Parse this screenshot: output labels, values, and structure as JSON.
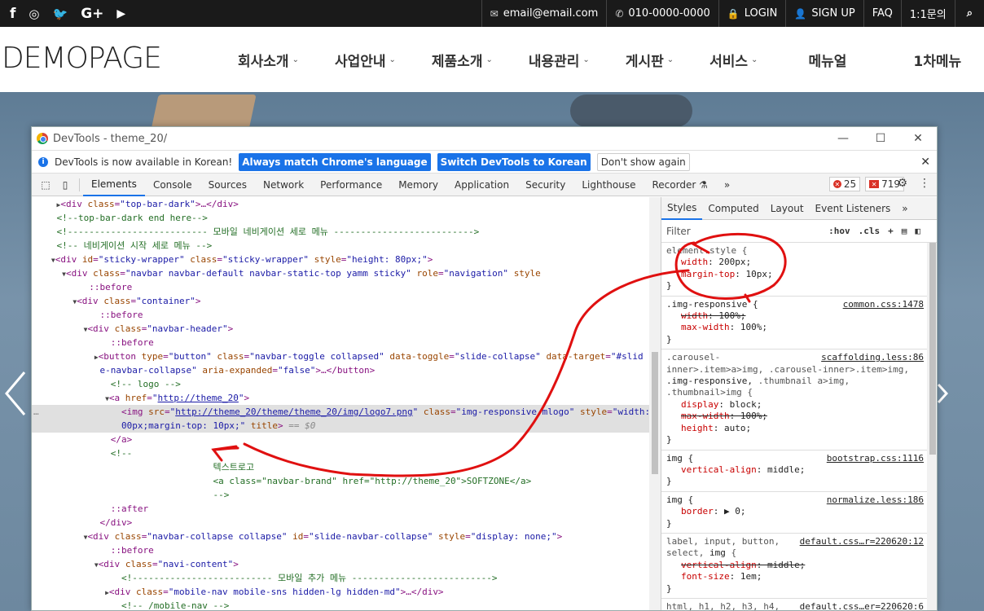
{
  "topbar": {
    "social": [
      "f",
      "ig",
      "tw",
      "G+",
      "yt"
    ],
    "email": "email@email.com",
    "phone": "010-0000-0000",
    "login": "LOGIN",
    "signup": "SIGN UP",
    "faq": "FAQ",
    "inquiry": "1:1문의"
  },
  "header": {
    "logo": "DEMOPAGE",
    "nav": [
      "회사소개",
      "사업안내",
      "제품소개",
      "내용관리",
      "게시판",
      "서비스",
      "메뉴얼",
      "1차메뉴"
    ]
  },
  "devtools": {
    "title": "DevTools - theme_20/",
    "infobar": {
      "message": "DevTools is now available in Korean!",
      "btn_match": "Always match Chrome's language",
      "btn_switch": "Switch DevTools to Korean",
      "btn_dismiss": "Don't show again"
    },
    "tabs": [
      "Elements",
      "Console",
      "Sources",
      "Network",
      "Performance",
      "Memory",
      "Application",
      "Security",
      "Lighthouse",
      "Recorder"
    ],
    "errors": "25",
    "warnings": "719",
    "styles_tabs": [
      "Styles",
      "Computed",
      "Layout",
      "Event Listeners"
    ],
    "filter_placeholder": "Filter",
    "hov": ":hov",
    "cls": ".cls"
  },
  "annotation": {
    "note": "텍스트로고",
    "note_code": "<a class=\"navbar-brand\" href=\"http://theme_20\">SOFTZONE</a>",
    "note_close": "-->"
  },
  "colors": {
    "annotation": "#e01010",
    "accent": "#1a73e8"
  }
}
